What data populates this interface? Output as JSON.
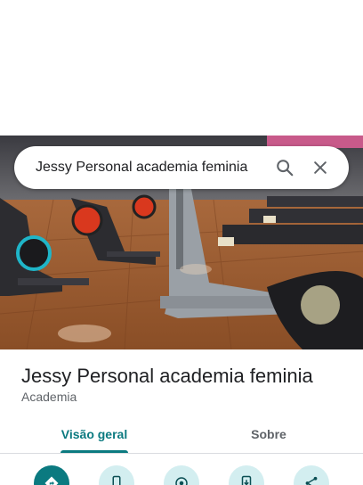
{
  "search": {
    "query": "Jessy Personal academia feminia"
  },
  "place": {
    "title": "Jessy Personal academia feminia",
    "category": "Academia"
  },
  "tabs": [
    {
      "label": "Visão geral",
      "active": true
    },
    {
      "label": "Sobre",
      "active": false
    }
  ],
  "actions": [
    {
      "icon": "directions-icon"
    },
    {
      "icon": "phone-icon"
    },
    {
      "icon": "location-icon"
    },
    {
      "icon": "save-to-phone-icon"
    },
    {
      "icon": "share-icon"
    }
  ],
  "colors": {
    "accent": "#0b7a80",
    "accent_light": "#d3eef0",
    "text_primary": "#202124",
    "text_secondary": "#5f6368"
  }
}
